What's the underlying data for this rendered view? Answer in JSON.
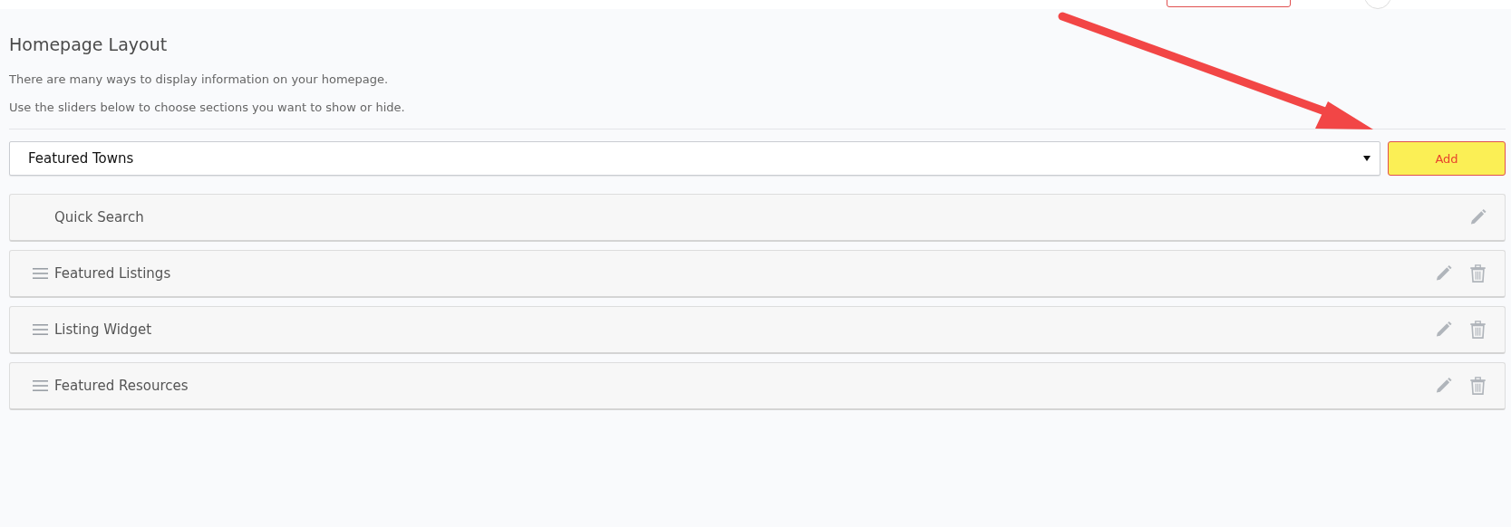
{
  "title": "Homepage Layout",
  "intro": [
    "There are many ways to display information on your homepage.",
    "Use the sliders below to choose sections you want to show or hide."
  ],
  "section_select": {
    "value": "Featured Towns"
  },
  "add_button": {
    "label": "Add",
    "highlighted": true
  },
  "sections": [
    {
      "name": "Quick Search",
      "draggable": false,
      "deletable": false
    },
    {
      "name": "Featured Listings",
      "draggable": true,
      "deletable": true
    },
    {
      "name": "Listing Widget",
      "draggable": true,
      "deletable": true
    },
    {
      "name": "Featured Resources",
      "draggable": true,
      "deletable": true
    }
  ]
}
